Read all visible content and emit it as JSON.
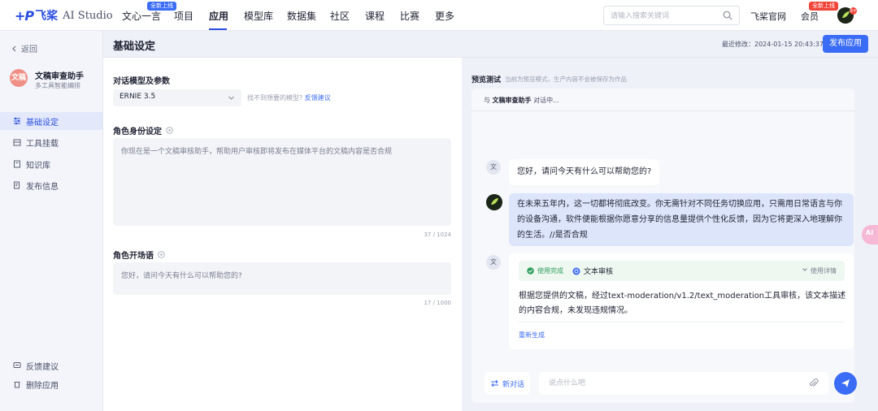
{
  "header": {
    "logo_mark": "+P",
    "logo_cn": "飞桨",
    "logo_en": "AI Studio",
    "nav": [
      {
        "label": "文心一言",
        "badge": "全新上线"
      },
      {
        "label": "项目"
      },
      {
        "label": "应用",
        "active": true
      },
      {
        "label": "模型库"
      },
      {
        "label": "数据集"
      },
      {
        "label": "社区"
      },
      {
        "label": "课程"
      },
      {
        "label": "比赛"
      },
      {
        "label": "更多"
      }
    ],
    "search_placeholder": "请输入搜索关键词",
    "official_site": "飞桨官网",
    "member": "会员",
    "member_badge": "全新上线",
    "notif_count": "9+",
    "accent": "#3b6cf5"
  },
  "sidebar": {
    "back": "返回",
    "app_avatar": "文稿",
    "app_name": "文稿审查助手",
    "app_sub": "多工具智能编排",
    "items": [
      {
        "label": "基础设定",
        "active": true
      },
      {
        "label": "工具挂载"
      },
      {
        "label": "知识库"
      },
      {
        "label": "发布信息"
      }
    ],
    "bottom": [
      {
        "label": "反馈建议"
      },
      {
        "label": "删除应用"
      }
    ]
  },
  "main": {
    "title": "基础设定",
    "last_edit": "最近修改：2024-01-15 20:43:37",
    "publish": "发布应用"
  },
  "config": {
    "model_label": "对话模型及参数",
    "model_value": "ERNIE 3.5",
    "model_hint": "找不到想要的模型?",
    "model_hint_link": "反馈建议",
    "role_label": "角色身份设定",
    "role_text": "你现在是一个文稿审核助手，帮助用户审核即将发布在媒体平台的文稿内容是否合规",
    "role_count": "37 / 1024",
    "opening_label": "角色开场语",
    "opening_text": "您好，请问今天有什么可以帮助您的?",
    "opening_count": "17 / 1000"
  },
  "preview": {
    "label": "预览测试",
    "hint": "当前为预览模式，生产内容不会被保存为作品",
    "chat_with_prefix": "与",
    "chat_with_name": "文稿审查助手",
    "chat_status": "对话中...",
    "bot_avatar": "文",
    "greeting": "您好，请问今天有什么可以帮助您的?",
    "user_message": "在未来五年内，这一切都将彻底改变。你无需针对不同任务切换应用，只需用日常语言与你的设备沟通，软件便能根据你愿意分享的信息量提供个性化反馈，因为它将更深入地理解你的生活。//是否合规",
    "tool_status": "使用完成",
    "tool_name": "文本审核",
    "tool_detail": "使用详情",
    "tool_result": "根据您提供的文稿，经过text-moderation/v1.2/text_moderation工具审核，该文本描述的内容合规，未发现违规情况。",
    "regenerate": "重新生成",
    "new_chat": "新对话",
    "input_placeholder": "说点什么吧",
    "float_tab": "AI"
  }
}
